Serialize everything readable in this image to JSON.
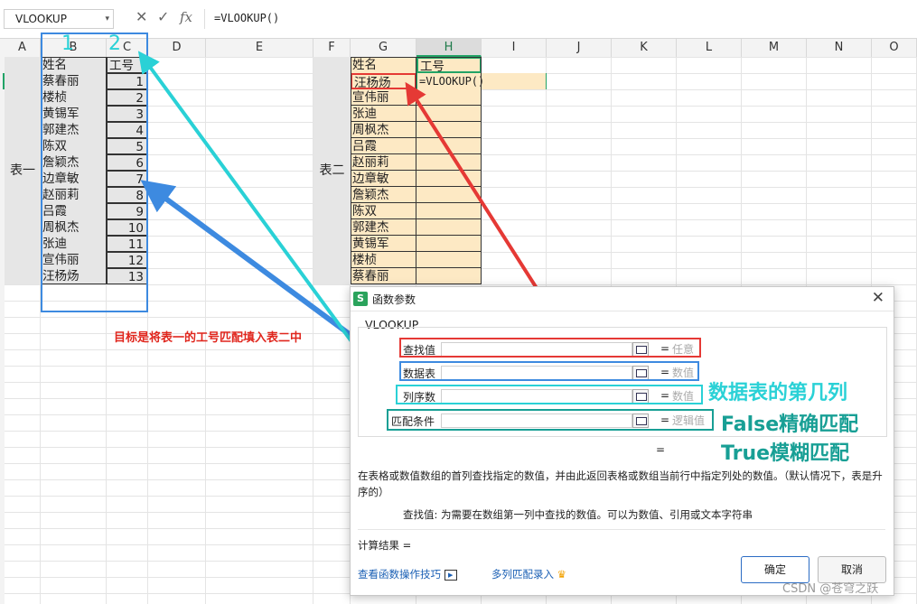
{
  "formula_bar": {
    "name_box": "VLOOKUP",
    "cancel_icon": "✕",
    "confirm_icon": "✓",
    "fx_label": "fx",
    "formula": "=VLOOKUP()"
  },
  "columns": [
    "A",
    "B",
    "C",
    "D",
    "E",
    "F",
    "G",
    "H",
    "I",
    "J",
    "K",
    "L",
    "M",
    "N",
    "O"
  ],
  "table1": {
    "merged_label": "表一",
    "header_name": "姓名",
    "header_id": "工号",
    "rows": [
      {
        "name": "蔡春丽",
        "id": "1"
      },
      {
        "name": "楼桢",
        "id": "2"
      },
      {
        "name": "黄锡军",
        "id": "3"
      },
      {
        "name": "郭建杰",
        "id": "4"
      },
      {
        "name": "陈双",
        "id": "5"
      },
      {
        "name": "詹颖杰",
        "id": "6"
      },
      {
        "name": "边章敏",
        "id": "7"
      },
      {
        "name": "赵丽莉",
        "id": "8"
      },
      {
        "name": "吕霞",
        "id": "9"
      },
      {
        "name": "周枫杰",
        "id": "10"
      },
      {
        "name": "张迪",
        "id": "11"
      },
      {
        "name": "宣伟丽",
        "id": "12"
      },
      {
        "name": "汪杨炀",
        "id": "13"
      }
    ]
  },
  "table2": {
    "merged_label": "表二",
    "header_name": "姓名",
    "header_id": "工号",
    "active_formula": "=VLOOKUP()",
    "rows": [
      "汪杨炀",
      "宣伟丽",
      "张迪",
      "周枫杰",
      "吕霞",
      "赵丽莉",
      "边章敏",
      "詹颖杰",
      "陈双",
      "郭建杰",
      "黄锡军",
      "楼桢",
      "蔡春丽"
    ]
  },
  "annotations": {
    "num1": "1",
    "num2": "2",
    "goal": "目标是将表一的工号匹配填入表二中",
    "col_index": "数据表的第几列",
    "false_text": "False精确匹配",
    "true_text": "True模糊匹配",
    "watermark": "CSDN @苍穹之跃"
  },
  "dialog": {
    "title": "函数参数",
    "logo": "S",
    "close": "✕",
    "function_name": "VLOOKUP",
    "args": [
      {
        "label": "查找值",
        "hint": "任意"
      },
      {
        "label": "数据表",
        "hint": "数值"
      },
      {
        "label": "列序数",
        "hint": "数值"
      },
      {
        "label": "匹配条件",
        "hint": "逻辑值"
      }
    ],
    "equals": "=",
    "description": "在表格或数值数组的首列查找指定的数值，并由此返回表格或数组当前行中指定列处的数值。（默认情况下，表是升序的）",
    "arg_desc": "查找值:  为需要在数组第一列中查找的数值。可以为数值、引用或文本字符串",
    "calc_result": "计算结果 =",
    "link_tips": "查看函数操作技巧",
    "link_multi": "多列匹配录入",
    "ok": "确定",
    "cancel": "取消"
  },
  "colors": {
    "red": "#e53935",
    "blue": "#3d8ae0",
    "cyan": "#2ad1d6",
    "teal": "#189f95",
    "green": "#21a366"
  }
}
